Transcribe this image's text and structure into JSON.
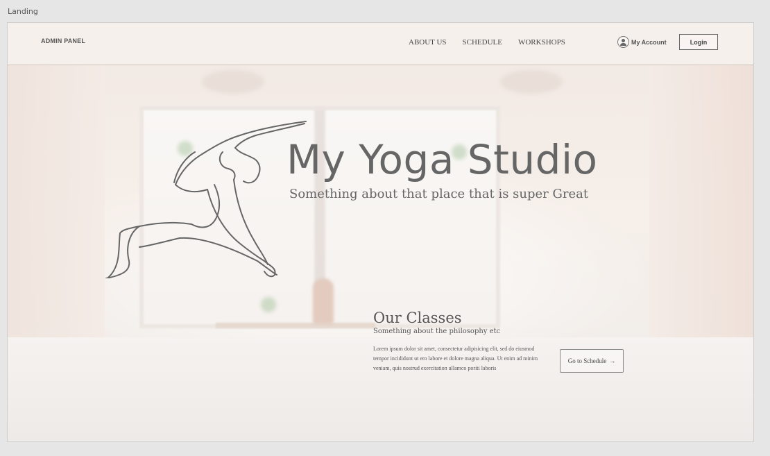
{
  "artboard": {
    "label": "Landing"
  },
  "nav": {
    "brand": "ADMIN PANEL",
    "links": [
      "ABOUT US",
      "SCHEDULE",
      "WORKSHOPS"
    ],
    "account_label": "My Account",
    "login_label": "Login"
  },
  "hero": {
    "title": "My Yoga Studio",
    "subtitle": "Something about that place that is super Great"
  },
  "classes": {
    "title": "Our Classes",
    "subtitle": "Something about the philosophy etc",
    "body": "Lorem ipsum dolor sit amet, consectetur adipisicing elit, sed do eiusmod tempor incididunt ut ero labore et dolore magna aliqua. Ut enim ad minim veniam, quis nostrud exercitation ullamco poriti laboris",
    "button_label": "Go to Schedule",
    "button_icon": "arrow-right-icon"
  },
  "icons": {
    "account": "user-circle-icon",
    "logo": "yoga-pose-line-art"
  },
  "colors": {
    "text_primary": "#666666",
    "background": "#f3ede8",
    "border": "#888888"
  }
}
